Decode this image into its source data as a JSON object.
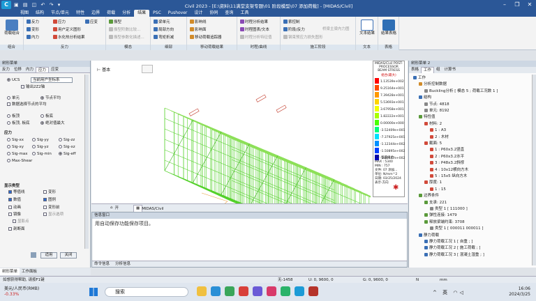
{
  "app": {
    "title": "Civil 2023 - [E:\\资料\\11满堂支架专题\\01 阶段模型\\07 添加荷载] - [MIDAS/Civil]",
    "logo": "C"
  },
  "menu": [
    "视图",
    "结构",
    "节点/单元",
    "特性",
    "边界",
    "荷载",
    "分析",
    "结果",
    "PSC",
    "Pushover",
    "设计",
    "协同",
    "查询",
    "工具"
  ],
  "menu_active": "结果",
  "ribbon": {
    "groups": [
      {
        "caption": "组合",
        "items": [
          "荷载组合"
        ]
      },
      {
        "caption": "反力",
        "items": [
          "反力",
          "变形",
          "内力",
          "应力",
          "用户定义图形",
          "水化热分析结果",
          "应变"
        ]
      },
      {
        "caption": "模态",
        "items": [
          "振型",
          "振型阶数比较...",
          "振型参数化描述..."
        ]
      },
      {
        "caption": "细部",
        "items": [
          "梁单元",
          "局部方向",
          "弯矩折减"
        ]
      },
      {
        "caption": "移动荷载结果",
        "items": [
          "影响线",
          "影响面",
          "移动荷载追踪器"
        ]
      },
      {
        "caption": "时程/曲线",
        "items": [
          "时程分析结果",
          "时程图表/文本",
          "时程分析特征值"
        ]
      },
      {
        "caption": "施工阶段",
        "items": [
          "索控制",
          "阶段/反力",
          "钢束预应力损失图形",
          "桥梁主梁内力图"
        ]
      },
      {
        "caption": "文本",
        "items": [
          "文本结果"
        ]
      },
      {
        "caption": "表格",
        "items": [
          "结果表格"
        ]
      }
    ]
  },
  "left_panel": {
    "header": "树形菜单",
    "tabs": [
      "反力",
      "位移",
      "内力",
      "应力",
      "应变"
    ],
    "active_tab": "应力",
    "coord_label": "UCS",
    "coord_value": "当前用户坐标系",
    "coord_option": "输出2Z2轴",
    "avg_options": [
      "单元",
      "节点平均",
      "数据选择节点的平均"
    ],
    "smooth_options": [
      "板顶",
      "板底",
      "板顶, 板底",
      "绝对值最大"
    ],
    "stress_label": "应力",
    "stress_options": [
      "Sig-xx",
      "Sig-yy",
      "Sig-zz",
      "Sig-xy",
      "Sig-yz",
      "Sig-xz",
      "Sig-max",
      "Sig-min",
      "Sig-eff",
      "Max-Shear"
    ],
    "display_label": "显示类型",
    "display_options": [
      "等值线",
      "变形",
      "数值",
      "图例",
      "动画",
      "变形前",
      "镜像",
      "显示选项",
      "显影点",
      "剖断面"
    ],
    "buttons": [
      "适用",
      "关闭"
    ]
  },
  "viewport": {
    "tab1": "开始",
    "tab2": "MIDAS/Civil",
    "label_base": "基本",
    "legend_title": "MIDAS/Civil POST-PROCESSOR BEAM STRESS",
    "legend_sub": "组合(最大)",
    "legend_values": [
      "1.13539e+002",
      "9.25164e+001",
      "7.39428e+001",
      "5.53693e+001",
      "3.67958e+001",
      "1.82222e+001",
      "0.00000e+000",
      "-3.52409e+001",
      "-7.37925e+001",
      "-1.12344e+002",
      "-1.50895e+002",
      "-1.89447e+002"
    ],
    "legend_colors": [
      "#ff0000",
      "#ff4a00",
      "#ff9900",
      "#ffd400",
      "#f2ff00",
      "#a9ff00",
      "#4cff00",
      "#00ff7a",
      "#00e0ff",
      "#0090ff",
      "#0040ff",
      "#0000c8"
    ],
    "info_lines": [
      "CB: 强度组合",
      "MAX : 5340",
      "MIN : 757",
      "文件: 07 添加...",
      "单位: N/mm^2",
      "日期: 03/25/2024",
      "表示-方向"
    ]
  },
  "message": {
    "header": "信息窗口",
    "text": "用自动保存功能保存项目。",
    "tabs": [
      "命令信息",
      "分析信息"
    ]
  },
  "right_panel": {
    "header": "树形菜单 2",
    "tabs": [
      "表格",
      "工作",
      "组",
      "计算书"
    ],
    "active_tab": "工作",
    "tree": [
      "工作",
      "分析控制数据",
      "Buckling分析 [ 模态 5 ; 荷载工况数 1 ]",
      "结构",
      "节点: 4818",
      "单元: 8192",
      "特性值",
      "材料: 2",
      "1 : A3",
      "2 : 木材",
      "截面: 5",
      "1 : P60x3.2竖直",
      "2 : P60x3.2水平",
      "3 : P48x3.2斜撑",
      "4 : 10x12横向方木",
      "5 : 15x5 纵向方木",
      "厚度: 1",
      "1 : 15",
      "边界条件",
      "支承: 221",
      "类型 1 [ 111000 ]",
      "弹性连接: 1479",
      "释放梁端约束: 3708",
      "类型 1 [ 000011 000011 ]",
      "静力荷载",
      "静力荷载工况 1 [ 自重 ; ]",
      "静力荷载工况 2 [ 施工荷载 ; ]",
      "静力荷载工况 3 [ 混凝土湿重 ; ]"
    ]
  },
  "bottom_tabs": [
    "树形菜单",
    "工作面板"
  ],
  "status": {
    "help": "如想获得帮助, 请按F1键",
    "node": "无-1458",
    "u1": "U: 0, 9600, 0",
    "g1": "G: 0, 9600, 0",
    "unit1": "N",
    "unit2": "mm"
  },
  "taskbar": {
    "stock_name": "美元/人民币(RMB)",
    "stock_change": "-0.33%",
    "search": "搜索",
    "time": "16:06",
    "date": "2024/3/25",
    "lang": "英"
  }
}
